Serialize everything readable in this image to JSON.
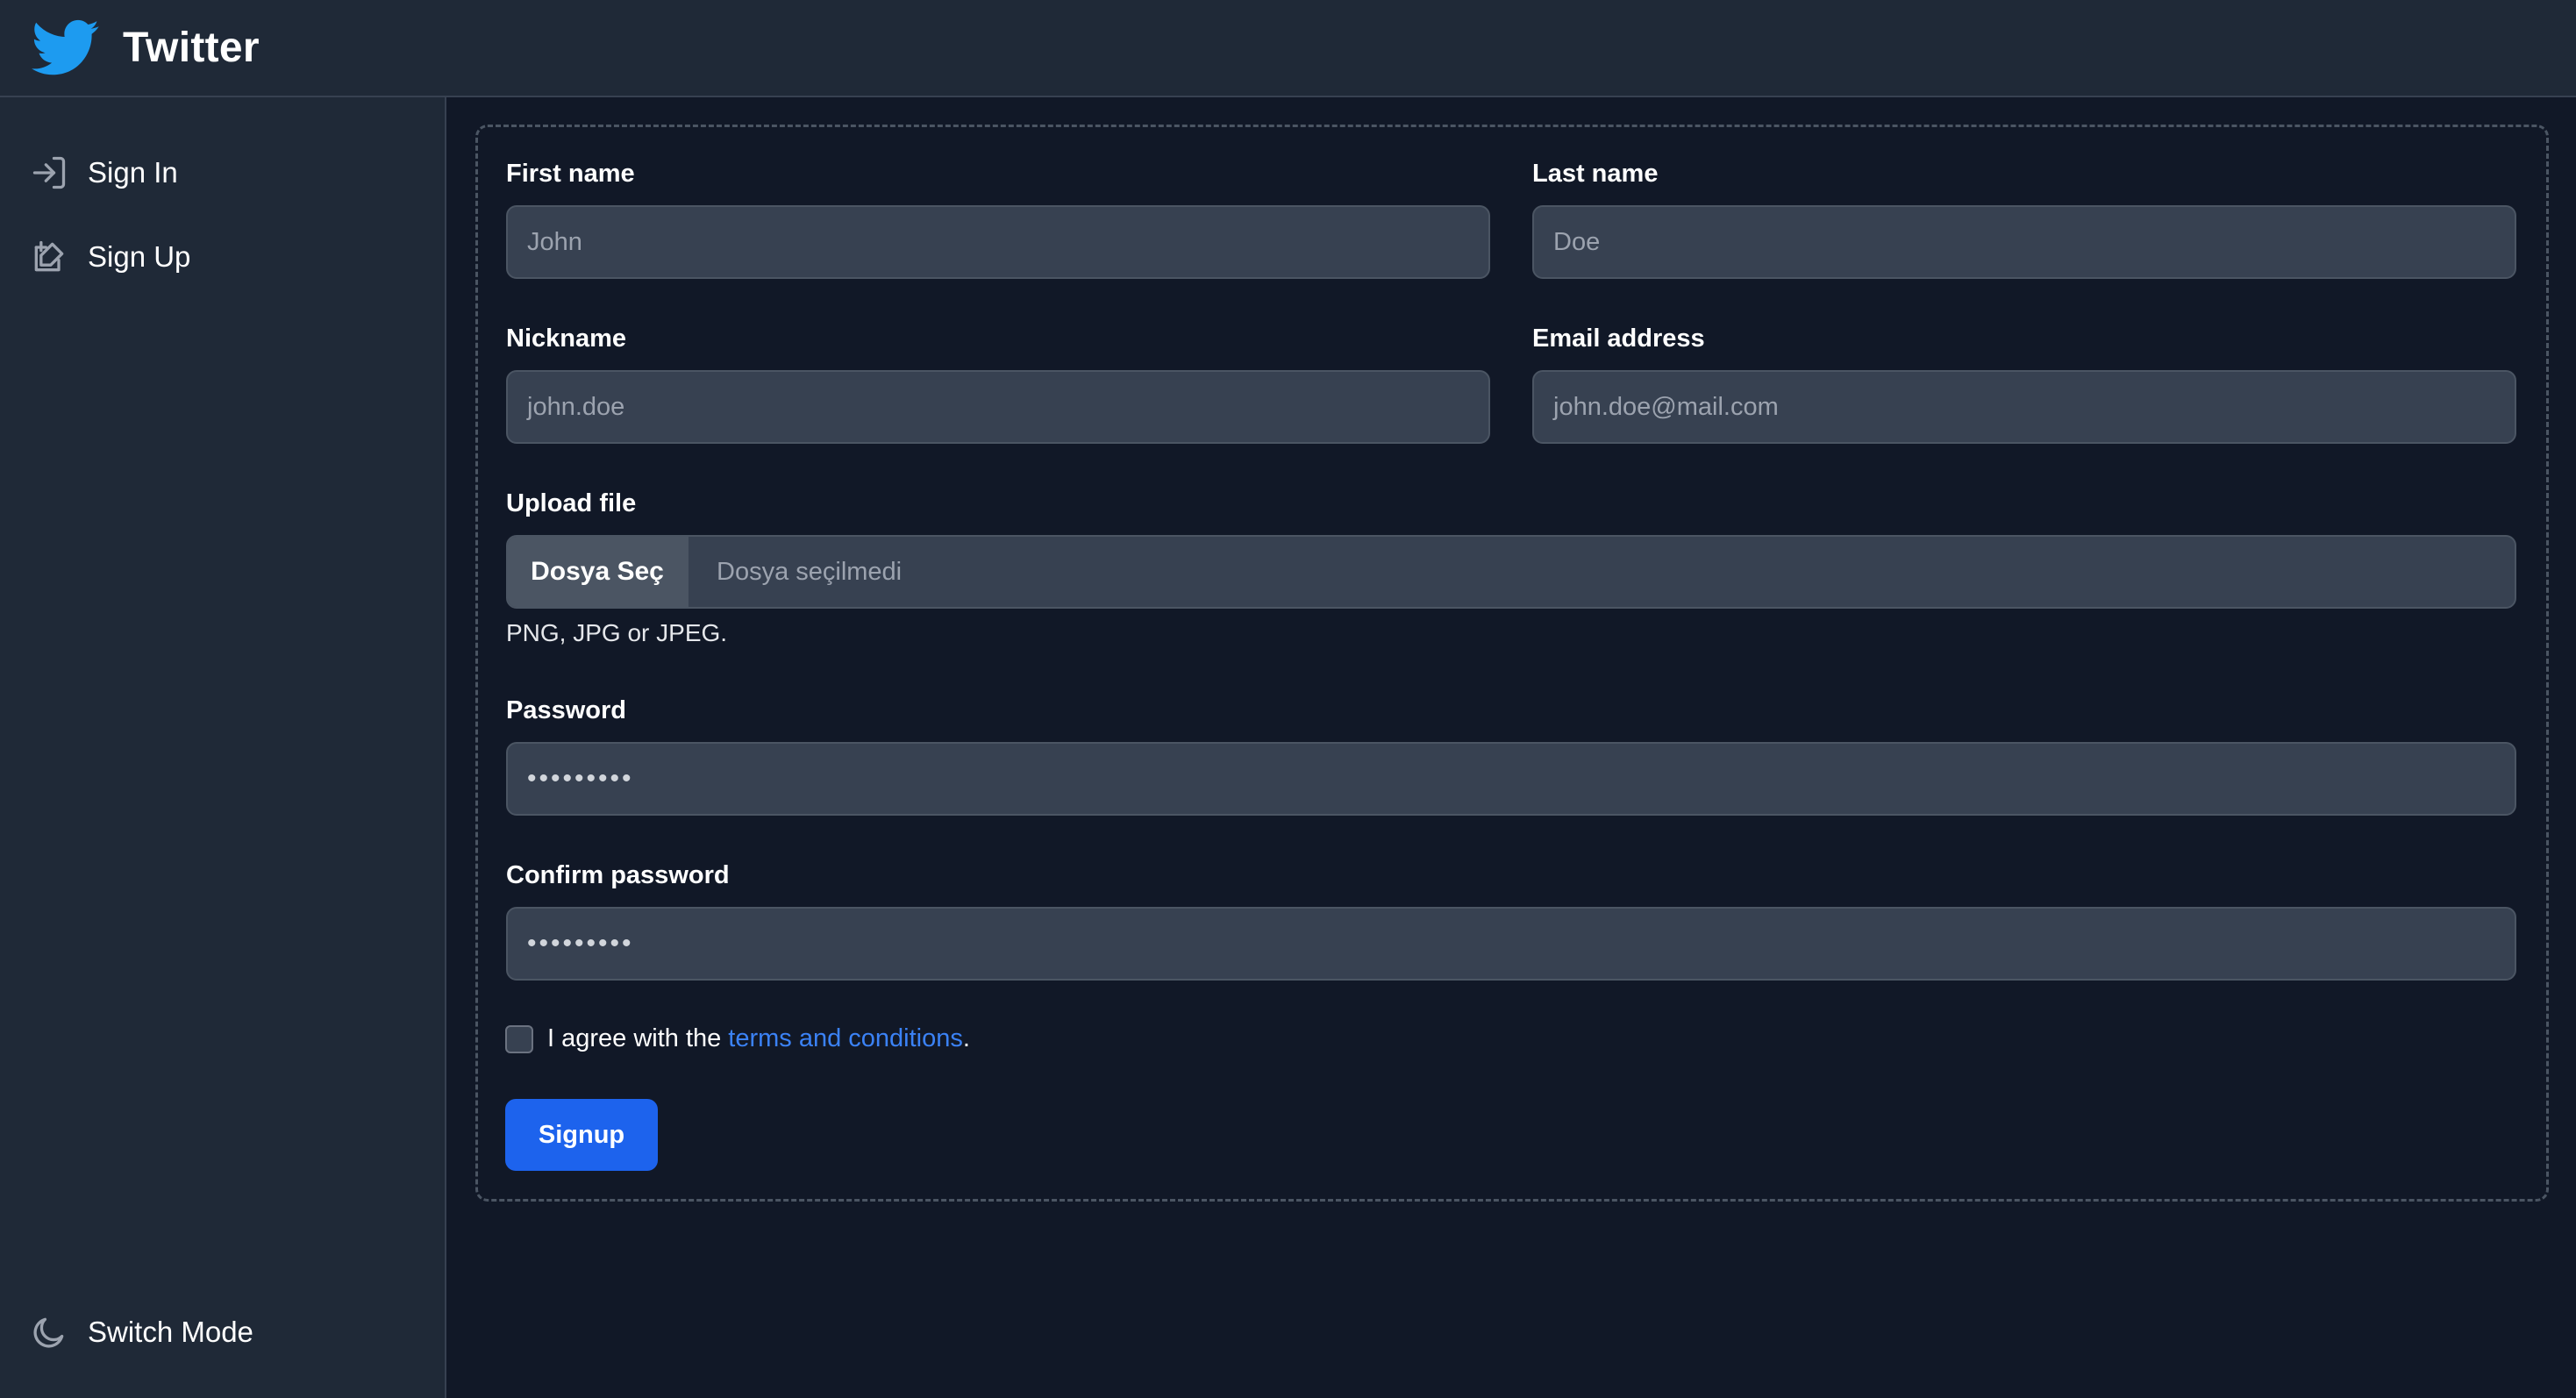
{
  "app": {
    "title": "Twitter",
    "logo_icon": "twitter-bird-icon",
    "brand_color": "#1d9bf0"
  },
  "sidebar": {
    "items": [
      {
        "label": "Sign In",
        "icon": "sign-in-icon"
      },
      {
        "label": "Sign Up",
        "icon": "sign-up-icon"
      }
    ],
    "footer": {
      "label": "Switch Mode",
      "icon": "moon-icon"
    }
  },
  "form": {
    "first_name": {
      "label": "First name",
      "placeholder": "John"
    },
    "last_name": {
      "label": "Last name",
      "placeholder": "Doe"
    },
    "nickname": {
      "label": "Nickname",
      "placeholder": "john.doe"
    },
    "email": {
      "label": "Email address",
      "placeholder": "john.doe@mail.com"
    },
    "upload": {
      "label": "Upload file",
      "button_label": "Dosya Seç",
      "status": "Dosya seçilmedi",
      "hint": "PNG, JPG or JPEG."
    },
    "password": {
      "label": "Password",
      "value": "•••••••••"
    },
    "confirm_password": {
      "label": "Confirm password",
      "value": "•••••••••"
    },
    "agree": {
      "prefix": "I agree with the",
      "link": "terms and conditions",
      "suffix": ".",
      "checked": false
    },
    "submit_label": "Signup"
  },
  "colors": {
    "accent": "#1d63ed",
    "link": "#3b82f6",
    "background": "#111827",
    "panel": "#1f2937",
    "input": "#374151"
  }
}
